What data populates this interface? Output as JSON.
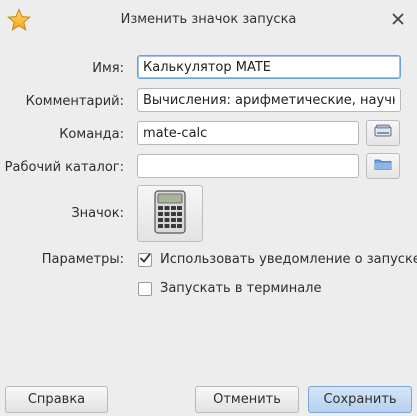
{
  "window": {
    "title": "Изменить значок запуска",
    "title_icon": "star-icon",
    "close_icon": "close-icon"
  },
  "form": {
    "name_label": "Имя:",
    "name_value": "Калькулятор MATE",
    "comment_label": "Комментарий:",
    "comment_value": "Вычисления: арифметические, научные",
    "command_label": "Команда:",
    "command_value": "mate-calc",
    "workdir_label": "Рабочий каталог:",
    "workdir_value": "",
    "icon_label": "Значок:",
    "icon_value": "calculator-icon",
    "params_label": "Параметры:",
    "notify_label": "Использовать уведомление о запуске",
    "notify_checked": true,
    "terminal_label": "Запускать в терминале",
    "terminal_checked": false
  },
  "buttons": {
    "help": "Справка",
    "cancel": "Отменить",
    "save": "Сохранить"
  },
  "colors": {
    "accent": "#6f9fd8",
    "primary_button": "#c5dbf4",
    "background": "#ededed"
  }
}
